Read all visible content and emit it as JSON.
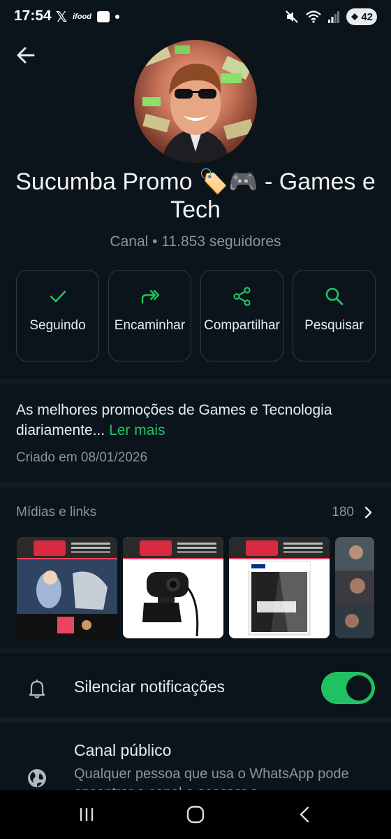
{
  "status_bar": {
    "time": "17:54",
    "app_icons": [
      "x-icon",
      "ifood-icon",
      "message-icon",
      "dot"
    ],
    "ifood_label": "ifood",
    "right_icons": [
      "mute-icon",
      "wifi-icon",
      "signal-icon"
    ],
    "battery": "42"
  },
  "header": {
    "title": "Sucumba Promo 🏷️🎮  - Games e Tech",
    "subtitle": "Canal • 11.853 seguidores"
  },
  "actions": [
    {
      "label": "Seguindo",
      "icon": "check-icon"
    },
    {
      "label": "Encaminhar",
      "icon": "forward-icon"
    },
    {
      "label": "Compartilhar",
      "icon": "share-icon"
    },
    {
      "label": "Pesquisar",
      "icon": "search-icon"
    }
  ],
  "about": {
    "description": "As melhores promoções de Games e Tecnologia diariamente...",
    "read_more": "Ler mais",
    "created": "Criado em 08/01/2026"
  },
  "media": {
    "title": "Mídias e links",
    "count": "180"
  },
  "settings": {
    "mute_label": "Silenciar notificações",
    "mute_on": true,
    "public_title": "Canal público",
    "public_desc": "Qualquer pessoa que usa o WhatsApp pode encontrar o canal e acessar o"
  },
  "colors": {
    "accent": "#21c063",
    "background": "#0b141a",
    "muted_text": "#8696a0"
  }
}
